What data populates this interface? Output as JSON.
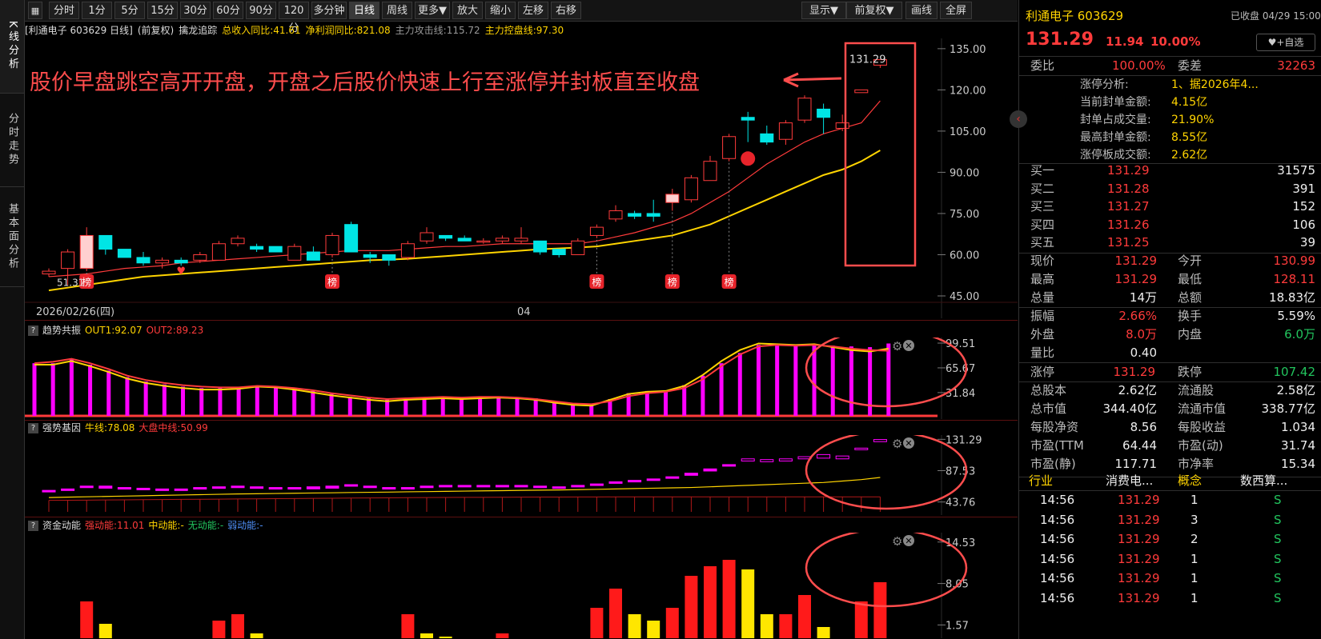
{
  "left_tabs": [
    {
      "label": "K线分析",
      "active": true
    },
    {
      "label": "分时走势",
      "active": false
    },
    {
      "label": "基本面分析",
      "active": false
    }
  ],
  "toolbar": {
    "items": [
      "分时",
      "1分",
      "5分",
      "15分",
      "30分",
      "60分",
      "90分",
      "120分",
      "多分钟",
      "日线",
      "周线",
      "更多▼",
      "放大",
      "缩小",
      "左移",
      "右移"
    ],
    "active_index": 9,
    "right_items": [
      "显示▼",
      "前复权▼",
      "画线",
      "全屏"
    ]
  },
  "info_bar": {
    "stock": "[利通电子 603629 日线]",
    "adjust": "(前复权)",
    "indicator_name": "擒龙追踪",
    "revenue_yoy": "总收入同比:41.61",
    "profit_yoy": "净利润同比:821.08",
    "main_attack": "主力攻击线:115.72",
    "main_control": "主力控盘线:97.30"
  },
  "main_chart": {
    "annotation": "股价早盘跳空高开开盘，开盘之后股价快速上行至涨停并封板直至收盘",
    "price_label": "131.29",
    "low_label": "51.31",
    "y_ticks": [
      "135.00",
      "120.00",
      "105.00",
      "90.00",
      "75.00",
      "60.00",
      "45.00"
    ],
    "date_left": "2026/02/26(四)",
    "date_mid": "04",
    "bang_label": "榜"
  },
  "indicators": [
    {
      "title": "趋势共振",
      "fields": [
        {
          "text": "OUT1:92.07",
          "color": "#ffd400"
        },
        {
          "text": "OUT2:89.23",
          "color": "#ff3b3b"
        }
      ],
      "ticks": [
        "99.51",
        "65.67",
        "31.84"
      ]
    },
    {
      "title": "强势基因",
      "fields": [
        {
          "text": "牛线:78.08",
          "color": "#ffd400"
        },
        {
          "text": "大盘中线:50.99",
          "color": "#ff3b3b"
        }
      ],
      "ticks": [
        "131.29",
        "87.53",
        "43.76"
      ]
    },
    {
      "title": "资金动能",
      "fields": [
        {
          "text": "强动能:11.01",
          "color": "#ff3b3b"
        },
        {
          "text": "中动能:-",
          "color": "#ffd400"
        },
        {
          "text": "无动能:-",
          "color": "#22c55e"
        },
        {
          "text": "弱动能:-",
          "color": "#4f8ff7"
        }
      ],
      "ticks": [
        "14.53",
        "8.05",
        "1.57"
      ]
    }
  ],
  "right_panel": {
    "name": "利通电子 603629",
    "status": "已收盘 04/29 15:00",
    "price": "131.29",
    "change": "11.94",
    "change_pct": "10.00%",
    "watch_button": "♥+自选",
    "weibi_label": "委比",
    "weibi": "100.00%",
    "weicha_label": "委差",
    "weicha": "32263",
    "limit_analysis": [
      {
        "label": "涨停分析:",
        "value": "1、据2026年4..."
      },
      {
        "label": "当前封单金额:",
        "value": "4.15亿"
      },
      {
        "label": "封单占成交量:",
        "value": "21.90%"
      },
      {
        "label": "最高封单金额:",
        "value": "8.55亿"
      },
      {
        "label": "涨停板成交额:",
        "value": "2.62亿"
      }
    ],
    "bids": [
      {
        "label": "买一",
        "price": "131.29",
        "vol": "31575"
      },
      {
        "label": "买二",
        "price": "131.28",
        "vol": "391"
      },
      {
        "label": "买三",
        "price": "131.27",
        "vol": "152"
      },
      {
        "label": "买四",
        "price": "131.26",
        "vol": "106"
      },
      {
        "label": "买五",
        "price": "131.25",
        "vol": "39"
      }
    ],
    "quote": [
      {
        "l1": "现价",
        "v1": "131.29",
        "c1": "red",
        "l2": "今开",
        "v2": "130.99",
        "c2": "red"
      },
      {
        "l1": "最高",
        "v1": "131.29",
        "c1": "red",
        "l2": "最低",
        "v2": "128.11",
        "c2": "red"
      },
      {
        "l1": "总量",
        "v1": "14万",
        "c1": "white",
        "l2": "总额",
        "v2": "18.83亿",
        "c2": "white"
      }
    ],
    "stats1": [
      {
        "l1": "振幅",
        "v1": "2.66%",
        "c1": "red",
        "l2": "换手",
        "v2": "5.59%",
        "c2": "white"
      },
      {
        "l1": "外盘",
        "v1": "8.0万",
        "c1": "red",
        "l2": "内盘",
        "v2": "6.0万",
        "c2": "green"
      },
      {
        "l1": "量比",
        "v1": "0.40",
        "c1": "white",
        "l2": "",
        "v2": "",
        "c2": "white"
      }
    ],
    "limits": {
      "l1": "涨停",
      "v1": "131.29",
      "l2": "跌停",
      "v2": "107.42"
    },
    "fundamentals": [
      {
        "l1": "总股本",
        "v1": "2.62亿",
        "l2": "流通股",
        "v2": "2.58亿"
      },
      {
        "l1": "总市值",
        "v1": "344.40亿",
        "l2": "流通市值",
        "v2": "338.77亿"
      },
      {
        "l1": "每股净资",
        "v1": "8.56",
        "l2": "每股收益",
        "v2": "1.034"
      },
      {
        "l1": "市盈(TTM",
        "v1": "64.44",
        "l2": "市盈(动)",
        "v2": "31.74"
      },
      {
        "l1": "市盈(静)",
        "v1": "117.71",
        "l2": "市净率",
        "v2": "15.34"
      }
    ],
    "sector": {
      "l1": "行业",
      "v1": "消费电...",
      "l2": "概念",
      "v2": "数西算..."
    },
    "ticks": [
      {
        "time": "14:56",
        "price": "131.29",
        "vol": "1",
        "side": "S"
      },
      {
        "time": "14:56",
        "price": "131.29",
        "vol": "3",
        "side": "S"
      },
      {
        "time": "14:56",
        "price": "131.29",
        "vol": "2",
        "side": "S"
      },
      {
        "time": "14:56",
        "price": "131.29",
        "vol": "1",
        "side": "S"
      },
      {
        "time": "14:56",
        "price": "131.29",
        "vol": "1",
        "side": "S"
      },
      {
        "time": "14:56",
        "price": "131.29",
        "vol": "1",
        "side": "S"
      }
    ]
  },
  "colors": {
    "up": "#ff3b3b",
    "down": "#00e5e5",
    "ma_red": "#ff3b3b",
    "ma_yellow": "#ffd400",
    "magenta": "#ff00ff",
    "highlight": "#ff4d4d"
  },
  "chart_data": {
    "type": "candlestick",
    "y_range": [
      45,
      137
    ],
    "candles": [
      [
        53,
        55,
        52,
        54
      ],
      [
        55,
        62,
        49,
        61
      ],
      [
        55,
        70,
        54,
        67
      ],
      [
        67,
        66,
        60,
        62
      ],
      [
        62,
        60,
        59,
        59
      ],
      [
        59,
        61,
        56,
        57
      ],
      [
        57,
        59,
        55,
        58
      ],
      [
        58,
        59,
        56,
        57
      ],
      [
        58,
        61,
        57,
        60
      ],
      [
        58,
        65,
        58,
        64
      ],
      [
        64,
        67,
        63,
        66
      ],
      [
        63,
        64,
        61,
        62
      ],
      [
        63,
        62,
        61,
        61
      ],
      [
        58,
        64,
        58,
        63
      ],
      [
        61,
        63,
        58,
        58
      ],
      [
        60,
        68,
        59,
        67
      ],
      [
        71,
        72,
        61,
        61
      ],
      [
        60,
        61,
        57,
        59
      ],
      [
        60,
        60,
        56,
        58
      ],
      [
        59,
        65,
        58,
        64
      ],
      [
        65,
        70,
        64,
        68
      ],
      [
        67,
        67,
        65,
        66
      ],
      [
        66,
        67,
        65,
        65
      ],
      [
        65,
        66,
        64,
        65
      ],
      [
        65,
        67,
        64,
        66
      ],
      [
        65,
        70,
        64,
        66
      ],
      [
        65,
        65,
        60,
        61
      ],
      [
        62,
        62,
        59,
        60
      ],
      [
        60,
        66,
        60,
        65
      ],
      [
        67,
        71,
        66,
        70
      ],
      [
        73,
        78,
        72,
        76
      ],
      [
        75,
        76,
        73,
        74
      ],
      [
        75,
        80,
        72,
        74
      ],
      [
        79,
        84,
        76,
        82
      ],
      [
        80,
        89,
        79,
        88
      ],
      [
        87,
        96,
        87,
        94
      ],
      [
        95,
        104,
        94,
        103
      ],
      [
        110,
        112,
        101,
        109
      ],
      [
        104,
        107,
        100,
        101
      ],
      [
        102,
        109,
        100,
        108
      ],
      [
        109,
        118,
        108,
        117
      ],
      [
        113,
        115,
        104,
        110
      ],
      [
        106,
        111,
        105,
        108
      ],
      [
        119,
        120,
        119,
        120
      ],
      [
        129,
        131,
        128,
        131
      ]
    ],
    "ma_red": [
      52,
      52.5,
      53,
      54,
      55,
      55.5,
      56,
      57,
      57.5,
      58,
      58.5,
      59,
      59.5,
      60,
      60.5,
      61,
      61.5,
      61.5,
      61.5,
      62,
      62.5,
      63,
      63,
      63.5,
      64,
      64,
      64,
      64,
      64,
      65,
      66.5,
      68,
      70,
      72,
      75,
      79,
      83,
      88,
      93,
      97,
      101,
      104,
      106,
      108,
      116
    ],
    "ma_yellow": [
      47,
      48,
      49,
      50,
      51,
      52,
      52.5,
      53,
      53.5,
      54,
      54.5,
      55,
      55.5,
      56,
      56.5,
      57,
      57.5,
      58,
      58.2,
      58.5,
      59,
      59.5,
      60,
      60.5,
      61,
      61.5,
      62,
      62.3,
      62.6,
      63,
      64,
      65,
      66,
      67,
      69,
      71,
      74,
      77,
      80,
      83,
      86,
      89,
      91,
      94,
      98
    ],
    "bang_at": [
      2,
      15,
      29,
      33,
      36
    ],
    "trend_bars": [
      72,
      72,
      78,
      70,
      62,
      53,
      47,
      43,
      40,
      38,
      38,
      38,
      41,
      40,
      38,
      34,
      30,
      26,
      24,
      22,
      24,
      25,
      26,
      24,
      25,
      26,
      25,
      24,
      20,
      17,
      16,
      23,
      31,
      34,
      35,
      42,
      55,
      72,
      86,
      97,
      96,
      96,
      98,
      96,
      95,
      94,
      99
    ],
    "trend_out1": [
      70,
      70,
      75,
      68,
      60,
      51,
      45,
      41,
      38,
      36,
      36,
      37,
      40,
      39,
      36,
      32,
      28,
      25,
      22,
      20,
      22,
      23,
      24,
      23,
      24,
      25,
      24,
      22,
      18,
      15,
      14,
      22,
      30,
      33,
      34,
      41,
      56,
      75,
      90,
      99,
      98,
      97,
      98,
      94,
      90,
      88,
      92
    ],
    "trend_out2": [
      72,
      74,
      78,
      72,
      64,
      55,
      49,
      45,
      42,
      40,
      39,
      39,
      41,
      40,
      38,
      35,
      31,
      28,
      25,
      23,
      24,
      25,
      26,
      25,
      26,
      26,
      25,
      23,
      20,
      17,
      16,
      20,
      27,
      31,
      33,
      38,
      50,
      68,
      84,
      95,
      97,
      96,
      97,
      95,
      92,
      90,
      89
    ],
    "strong_boxes": [
      [
        60,
        58
      ],
      [
        62,
        60
      ],
      [
        66,
        64
      ],
      [
        66,
        63
      ],
      [
        64,
        62
      ],
      [
        63,
        61
      ],
      [
        62,
        60
      ],
      [
        62,
        60
      ],
      [
        64,
        62
      ],
      [
        65,
        63
      ],
      [
        66,
        64
      ],
      [
        65,
        63
      ],
      [
        64,
        62
      ],
      [
        64,
        62
      ],
      [
        65,
        62
      ],
      [
        66,
        63
      ],
      [
        68,
        66
      ],
      [
        66,
        64
      ],
      [
        64,
        62
      ],
      [
        64,
        62
      ],
      [
        66,
        64
      ],
      [
        67,
        65
      ],
      [
        67,
        65
      ],
      [
        67,
        65
      ],
      [
        67,
        65
      ],
      [
        67,
        65
      ],
      [
        66,
        64
      ],
      [
        65,
        63
      ],
      [
        67,
        65
      ],
      [
        69,
        67
      ],
      [
        72,
        70
      ],
      [
        74,
        72
      ],
      [
        76,
        74
      ],
      [
        79,
        77
      ],
      [
        84,
        81
      ],
      [
        90,
        87
      ],
      [
        96,
        94
      ],
      [
        104,
        101
      ],
      [
        103,
        100
      ],
      [
        104,
        101
      ],
      [
        107,
        104
      ],
      [
        110,
        105
      ],
      [
        108,
        104
      ],
      [
        119,
        118
      ],
      [
        131,
        128
      ]
    ],
    "strong_bull": [
      50,
      50.5,
      51,
      51.5,
      52,
      52.5,
      53,
      53.5,
      54,
      54.5,
      55,
      55.3,
      55.6,
      56,
      56.3,
      56.6,
      57,
      57.3,
      57.6,
      58,
      58.3,
      58.6,
      59,
      59.3,
      59.6,
      60,
      60.3,
      60.6,
      61,
      61.5,
      62,
      62.5,
      63,
      63.5,
      64,
      65,
      66,
      67,
      68,
      69,
      70,
      71,
      73,
      75,
      78
    ],
    "strong_base": [
      46,
      46.2,
      46.4,
      46.6,
      46.8,
      47,
      47.2,
      47.4,
      47.6,
      47.8,
      48,
      48.2,
      48.4,
      48.6,
      48.8,
      49,
      49.2,
      49.4,
      49.6,
      49.8,
      50,
      50.1,
      50.2,
      50.3,
      50.4,
      50.5,
      50.6,
      50.7,
      50.8,
      50.8,
      50.9,
      50.9,
      51,
      51,
      51,
      51,
      51,
      51,
      51,
      51,
      51,
      51,
      51,
      51,
      51
    ],
    "money": [
      [
        2,
        "green"
      ],
      [
        1,
        "red"
      ],
      [
        8,
        "red"
      ],
      [
        4.5,
        "yellow"
      ],
      [
        0,
        "yellow"
      ],
      [
        0,
        "yellow"
      ],
      [
        2,
        "green"
      ],
      [
        1.5,
        "blue"
      ],
      [
        1,
        "red"
      ],
      [
        5,
        "red"
      ],
      [
        6,
        "red"
      ],
      [
        3,
        "yellow"
      ],
      [
        1,
        "yellow"
      ],
      [
        2,
        "green"
      ],
      [
        1.5,
        "blue"
      ],
      [
        1,
        "yellow"
      ],
      [
        5,
        "green"
      ],
      [
        6,
        "blue"
      ],
      [
        1,
        "red"
      ],
      [
        6,
        "red"
      ],
      [
        3,
        "yellow"
      ],
      [
        2.5,
        "yellow"
      ],
      [
        2,
        "yellow"
      ],
      [
        1,
        "yellow"
      ],
      [
        3,
        "red"
      ],
      [
        5,
        "green"
      ],
      [
        4,
        "green"
      ],
      [
        2,
        "yellow"
      ],
      [
        1,
        "yellow"
      ],
      [
        7,
        "red"
      ],
      [
        10,
        "red"
      ],
      [
        6,
        "yellow"
      ],
      [
        5,
        "yellow"
      ],
      [
        7,
        "red"
      ],
      [
        12,
        "red"
      ],
      [
        13.5,
        "red"
      ],
      [
        14.5,
        "red"
      ],
      [
        13,
        "yellow"
      ],
      [
        6,
        "yellow"
      ],
      [
        6,
        "red"
      ],
      [
        9,
        "red"
      ],
      [
        4,
        "yellow"
      ],
      [
        1.5,
        "yellow"
      ],
      [
        8,
        "red"
      ],
      [
        11,
        "red"
      ]
    ]
  }
}
